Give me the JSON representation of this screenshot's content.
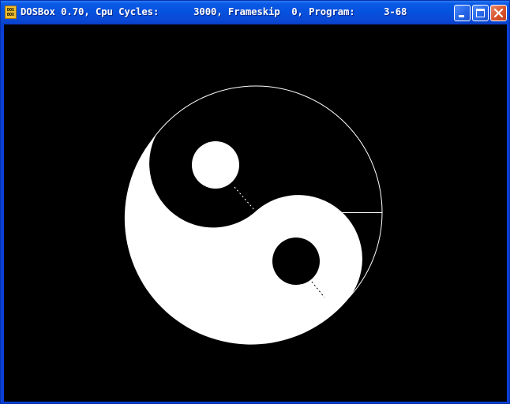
{
  "window": {
    "title": "DOSBox 0.70, Cpu Cycles:      3000, Frameskip  0, Program:     3-68",
    "icon_text_top": "DOS",
    "icon_text_bottom": "BOX",
    "icons": {
      "app": "dosbox-icon",
      "minimize": "minimize-icon",
      "maximize": "maximize-icon",
      "close": "close-icon"
    }
  },
  "colors": {
    "titlebar": "#0552de",
    "screen_background": "#000000",
    "drawing": "#ffffff"
  }
}
